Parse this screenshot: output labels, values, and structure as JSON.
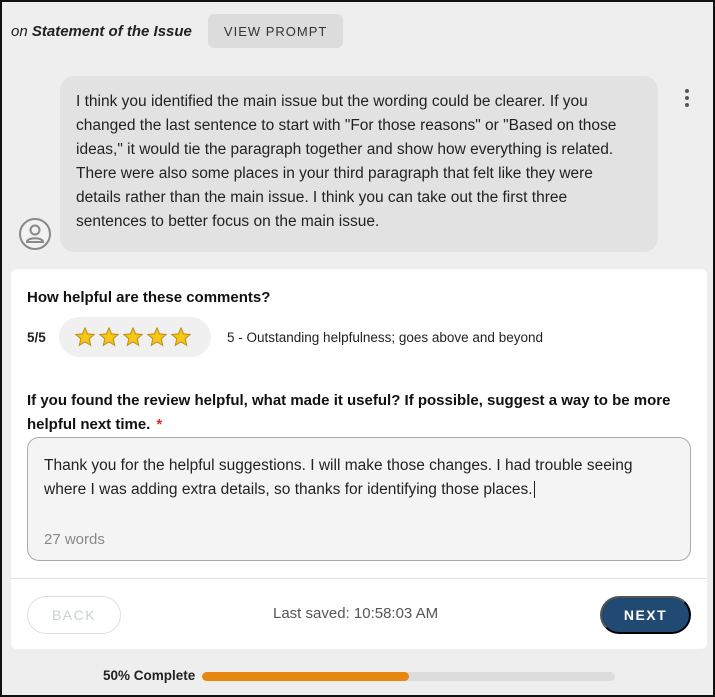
{
  "header": {
    "on_prefix": "on",
    "item_title": "Statement of the Issue",
    "view_prompt_label": "VIEW PROMPT"
  },
  "review": {
    "avatar_icon": "user-avatar-icon",
    "menu_icon": "more-vertical-icon",
    "comment": "I think you identified the main issue but the wording could be clearer. If you changed the last sentence to start with \"For those reasons\" or \"Based on those ideas,\" it would tie the paragraph together and show how everything is related. There were also some places in your third paragraph that felt like they were details rather than the main issue. I think you can take out the first three sentences to better focus on the main issue."
  },
  "feedback": {
    "question1": "How helpful are these comments?",
    "score_label": "5/5",
    "rating": 5,
    "max_rating": 5,
    "rating_description": "5 - Outstanding helpfulness; goes above and beyond",
    "star_color": "#f5c518",
    "question2": "If you found the review helpful, what made it useful? If possible, suggest a way to be more helpful next time.",
    "required_mark": "*",
    "response_text": "Thank you for the helpful suggestions. I will make those changes. I had trouble seeing where I was adding extra details, so thanks for identifying those places.",
    "word_count": "27 words"
  },
  "footer": {
    "back_label": "BACK",
    "last_saved": "Last saved: 10:58:03 AM",
    "next_label": "NEXT",
    "next_color": "#214a72"
  },
  "progress": {
    "label": "50% Complete",
    "fraction": 0.5,
    "color": "#e8870f"
  }
}
